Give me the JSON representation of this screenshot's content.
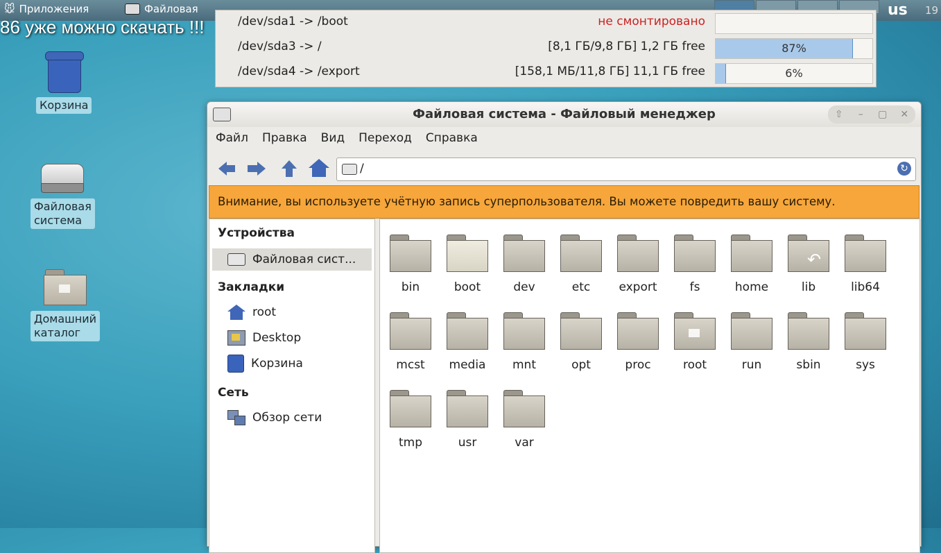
{
  "top_panel": {
    "apps_menu": "Приложения",
    "task_title": "Файловая",
    "keyboard_layout": "us",
    "clock": "19"
  },
  "overlay_caption": "86 уже можно скачать !!!",
  "mounts": [
    {
      "path": "/dev/sda1 -> /boot",
      "info": "не смонтировано",
      "percent": null,
      "percent_label": ""
    },
    {
      "path": "/dev/sda3 -> /",
      "info": "[8,1 ГБ/9,8 ГБ] 1,2 ГБ free",
      "percent": 87,
      "percent_label": "87%"
    },
    {
      "path": "/dev/sda4 -> /export",
      "info": "[158,1 МБ/11,8 ГБ] 11,1 ГБ free",
      "percent": 6,
      "percent_label": "6%"
    }
  ],
  "desktop_icons": {
    "trash": "Корзина",
    "filesystem": "Файловая\nсистема",
    "home": "Домашний\nкаталог"
  },
  "window": {
    "title": "Файловая система - Файловый менеджер",
    "menu": [
      "Файл",
      "Правка",
      "Вид",
      "Переход",
      "Справка"
    ],
    "location": "/",
    "warning": "Внимание, вы используете учётную запись суперпользователя. Вы можете повредить вашу систему."
  },
  "sidebar": {
    "devices_header": "Устройства",
    "devices": [
      "Файловая сист..."
    ],
    "bookmarks_header": "Закладки",
    "bookmarks": [
      "root",
      "Desktop",
      "Корзина"
    ],
    "network_header": "Сеть",
    "network": [
      "Обзор сети"
    ]
  },
  "folders": [
    "bin",
    "boot",
    "dev",
    "etc",
    "export",
    "fs",
    "home",
    "lib",
    "lib64",
    "mcst",
    "media",
    "mnt",
    "opt",
    "proc",
    "root",
    "run",
    "sbin",
    "sys",
    "tmp",
    "usr",
    "var"
  ],
  "colors": {
    "warning_bg": "#f6a63a",
    "accent_blue": "#3f66b7",
    "unmounted_text": "#cc2222"
  }
}
